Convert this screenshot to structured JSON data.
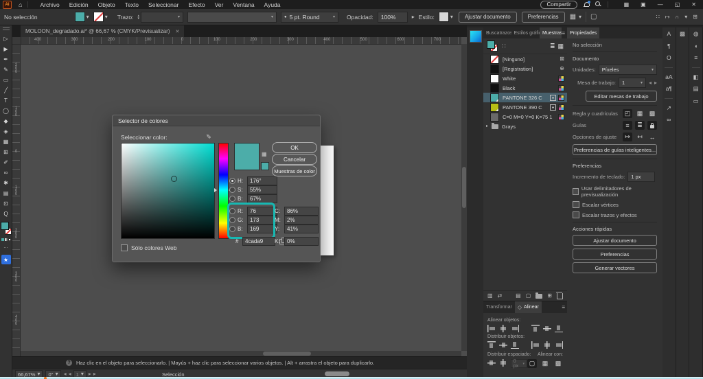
{
  "menubar": {
    "logo": "Ai",
    "items": [
      "Archivo",
      "Edición",
      "Objeto",
      "Texto",
      "Seleccionar",
      "Efecto",
      "Ver",
      "Ventana",
      "Ayuda"
    ],
    "share_button": "Compartir"
  },
  "controlbar": {
    "selection": "No selección",
    "stroke_label": "Trazo:",
    "brush_value": "5 pt. Round",
    "opacity_label": "Opacidad:",
    "opacity_value": "100%",
    "style_label": "Estilo:",
    "fit_document": "Ajustar documento",
    "preferences": "Preferencias"
  },
  "doc_tab": {
    "title": "MOLOON_degradado.ai* @ 66,67 % (CMYK/Previsualizar)"
  },
  "rulers": {
    "horizontal": [
      "400",
      "300",
      "200",
      "100",
      "0",
      "100",
      "200",
      "300",
      "400",
      "500",
      "600",
      "700"
    ],
    "vertical": [
      "200",
      "100",
      "0",
      "100",
      "200",
      "300",
      "400"
    ]
  },
  "toolbar": {
    "tools": [
      {
        "name": "selection-tool",
        "glyph": "▷"
      },
      {
        "name": "direct-selection-tool",
        "glyph": "▶"
      },
      {
        "name": "pen-tool",
        "glyph": "✒"
      },
      {
        "name": "pencil-tool",
        "glyph": "✎"
      },
      {
        "name": "rectangle-tool",
        "glyph": "▭"
      },
      {
        "name": "line-tool",
        "glyph": "╱"
      },
      {
        "name": "type-tool",
        "glyph": "T"
      },
      {
        "name": "rotate-tool",
        "glyph": "◯"
      },
      {
        "name": "scale-tool",
        "glyph": "◆"
      },
      {
        "name": "width-tool",
        "glyph": "◈"
      },
      {
        "name": "gradient-tool",
        "glyph": "▦"
      },
      {
        "name": "mesh-tool",
        "glyph": "⊞"
      },
      {
        "name": "eyedropper-tool",
        "glyph": "✐"
      },
      {
        "name": "blend-tool",
        "glyph": "∞"
      },
      {
        "name": "symbol-sprayer-tool",
        "glyph": "✱"
      },
      {
        "name": "graph-tool",
        "glyph": "▤"
      },
      {
        "name": "artboard-tool",
        "glyph": "⊡"
      },
      {
        "name": "zoom-tool",
        "glyph": "Q"
      }
    ],
    "more": "…",
    "edit_toolbar_glyph": "★"
  },
  "color_picker": {
    "title": "Selector de colores",
    "select_color_label": "Seleccionar color:",
    "ok": "OK",
    "cancel": "Cancelar",
    "swatches_button": "Muestras de color",
    "h_label": "H:",
    "h": "176°",
    "s_label": "S:",
    "s": "55%",
    "b_label": "B:",
    "b": "67%",
    "r_label": "R:",
    "r": "76",
    "g_label": "G:",
    "g": "173",
    "b2_label": "B:",
    "b2": "169",
    "hex_label": "#",
    "hex": "4cada9",
    "c_label": "C:",
    "c": "86%",
    "m_label": "M:",
    "m": "2%",
    "y_label": "Y:",
    "y": "41%",
    "k_label": "K:",
    "k": "0%",
    "web_only": "Sólo colores Web",
    "current_color": "#4cada9",
    "highlight_color": "#17b9b3"
  },
  "swatches": {
    "tabs": [
      "Buscatrazos",
      "Estilos gráfic",
      "Muestras"
    ],
    "rows": [
      {
        "label": "[Ninguno]"
      },
      {
        "label": "[Registration]",
        "color": "#111111"
      },
      {
        "label": "White",
        "color": "#ffffff"
      },
      {
        "label": "Black",
        "color": "#111111"
      },
      {
        "label": "PANTONE 326 C",
        "color": "#4cada9"
      },
      {
        "label": "PANTONE 390 C",
        "color": "#b7bf14"
      },
      {
        "label": "C=0 M=0 Y=0 K=75 1",
        "color": "#696969"
      },
      {
        "label": "Grays"
      }
    ]
  },
  "align_panel": {
    "tabs": [
      "Transformar",
      "Alinear"
    ],
    "align_objects": "Alinear objetos:",
    "distribute_objects": "Distribuir objetos:",
    "distribute_spacing": "Distribuir espaciado:",
    "align_to": "Alinear con:",
    "spacing_value": "0 px"
  },
  "properties": {
    "tab": "Propiedades",
    "no_selection": "No selección",
    "document_section": "Documento",
    "units_label": "Unidades:",
    "units_value": "Píxeles",
    "artboard_label": "Mesa de trabajo:",
    "artboard_value": "1",
    "edit_artboards": "Editar mesas de trabajo",
    "rulers_grids_label": "Regla y cuadrículas",
    "guides_label": "Guías",
    "snap_label": "Opciones de ajuste",
    "smart_guides_button": "Preferencias de guías inteligentes...",
    "preferences_section": "Preferencias",
    "kbd_increment_label": "Incremento de teclado:",
    "kbd_increment_value": "1 px",
    "check1": "Usar delimitadores de previsualización",
    "check2": "Escalar vértices",
    "check3": "Escalar trazos y efectos",
    "quick_actions_section": "Acciones rápidas",
    "qa1": "Ajustar documento",
    "qa2": "Preferencias",
    "qa3": "Generar vectores"
  },
  "hintbar": "Haz clic en el objeto para seleccionarlo.   |   Mayús + haz clic para seleccionar varios objetos.   |   Alt + arrastra el objeto para duplicarlo.",
  "statusbar": {
    "zoom": "66,67%",
    "rotation": "0°",
    "page": "1",
    "tool": "Selección"
  },
  "icons": {
    "chevron_down": "▾",
    "chevron_up": "▴",
    "chevron_left": "◂",
    "chevron_right": "▸",
    "close": "✕",
    "minimize": "—",
    "restore": "◱",
    "home": "⌂",
    "hamburger": "≡",
    "list_view": "≣",
    "grid_view": "▦",
    "none_swatch": "⊠",
    "registration": "⊕",
    "new_swatch": "⊞",
    "kinds_menu": "▤",
    "libraries": "▥",
    "swap": "⇄",
    "options_box": "▢",
    "pattern": "∷",
    "layout_a": "▦",
    "layout_b": "▣",
    "eyedropper": "✎",
    "mini_swatches": "▦",
    "arrange": "∩",
    "snap_grid": "⊞",
    "tab_key": "↦",
    "ruler_corner": "◰",
    "grid": "▦",
    "pixel_grid": "▩",
    "guide_a": "≡",
    "guide_b": "≣",
    "snap_a": "↦",
    "snap_b": "↤",
    "snap_c": "↔",
    "panel_char": "A",
    "panel_paragraph": "¶",
    "panel_opentype": "O",
    "panel_charstyles": "aA",
    "panel_parastyles": "a¶",
    "panel_export": "↗",
    "panel_links": "∞",
    "panel_gradient": "▩",
    "panel_appearance": "◍",
    "panel_shape": "◖",
    "panel_stroke": "≡",
    "panel_pathfinder": "◧",
    "panel_layers": "▤",
    "panel_artboards": "▭",
    "align_tab_marker": "◇",
    "expander": "▸"
  }
}
